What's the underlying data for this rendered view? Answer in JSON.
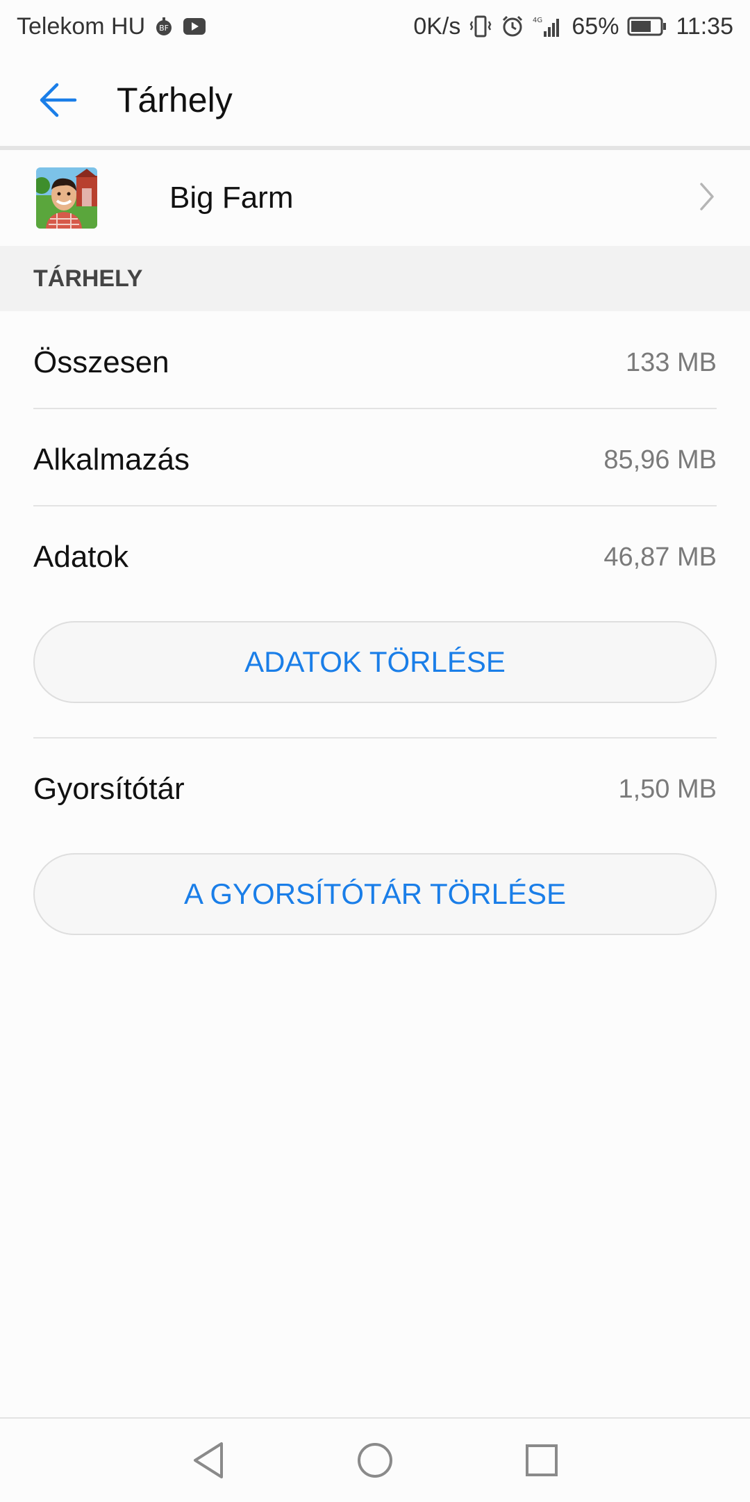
{
  "status_bar": {
    "carrier": "Telekom HU",
    "speed": "0K/s",
    "network": "4G",
    "battery": "65%",
    "time": "11:35",
    "icons": [
      "bigfarm-notif-icon",
      "youtube-icon",
      "vibrate-icon",
      "alarm-icon",
      "signal-icon",
      "battery-icon"
    ]
  },
  "appbar": {
    "title": "Tárhely",
    "back_icon": "arrow-back-icon"
  },
  "app": {
    "name": "Big Farm",
    "icon": "big-farm-app-icon"
  },
  "section": {
    "header": "TÁRHELY"
  },
  "storage": {
    "total_label": "Összesen",
    "total_value": "133 MB",
    "app_label": "Alkalmazás",
    "app_value": "85,96 MB",
    "data_label": "Adatok",
    "data_value": "46,87 MB",
    "clear_data_button": "ADATOK TÖRLÉSE",
    "cache_label": "Gyorsítótár",
    "cache_value": "1,50 MB",
    "clear_cache_button": "A GYORSÍTÓTÁR TÖRLÉSE"
  },
  "colors": {
    "accent": "#1a7ee8",
    "section_bg": "#f2f2f2",
    "value_text": "#7a7a7a"
  },
  "navbar": {
    "icons": [
      "back-triangle-icon",
      "home-circle-icon",
      "recents-square-icon"
    ]
  }
}
